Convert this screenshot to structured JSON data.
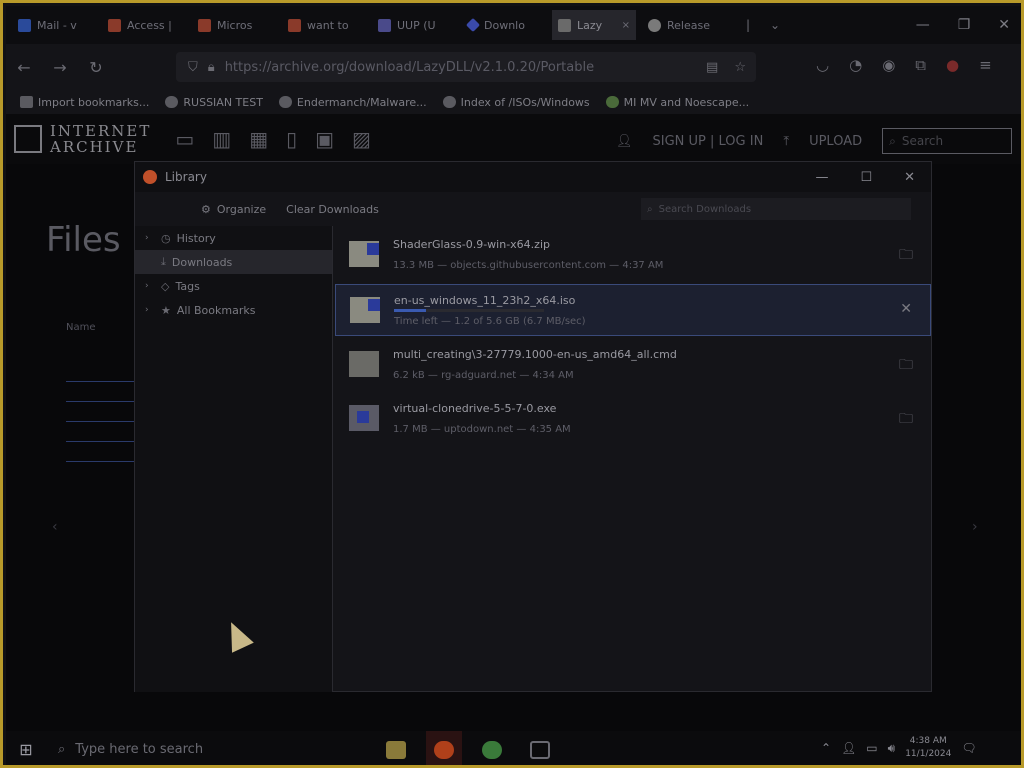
{
  "browser": {
    "tabs": [
      {
        "label": "Mail - v",
        "icon": "mail-icon",
        "color": "#2a4a9a"
      },
      {
        "label": "Access |",
        "icon": "microsoft-icon",
        "color": "#8a3a2a"
      },
      {
        "label": "Micros",
        "icon": "microsoft-icon",
        "color": "#8a3a2a"
      },
      {
        "label": "want to",
        "icon": "microsoft-icon",
        "color": "#8a3a2a"
      },
      {
        "label": "UUP (U",
        "icon": "page-icon",
        "color": "#4a4a8a"
      },
      {
        "label": "Downlo",
        "icon": "diamond-icon",
        "color": "#3a4aaa"
      },
      {
        "label": "Lazy",
        "icon": "archive-icon",
        "color": "#6a6a6a"
      },
      {
        "label": "Release",
        "icon": "github-icon",
        "color": "#7a7a7a"
      }
    ],
    "tab_close": "×",
    "url": "https://archive.org/download/LazyDLL/v2.1.0.20/Portable",
    "bookmarks": [
      "Import bookmarks...",
      "RUSSIAN TEST",
      "Endermanch/Malware...",
      "Index of /ISOs/Windows",
      "MI MV and Noescape..."
    ]
  },
  "page": {
    "logo_line1": "INTERNET",
    "logo_line2": "ARCHIVE",
    "signup": "SIGN UP | LOG IN",
    "upload": "UPLOAD",
    "search_placeholder": "Search",
    "files_title": "Files",
    "name_column": "Name"
  },
  "library": {
    "title": "Library",
    "organize": "Organize",
    "clear_downloads": "Clear Downloads",
    "search_placeholder": "Search Downloads",
    "sidebar": [
      {
        "label": "History",
        "icon": "clock-icon",
        "twisty": "›"
      },
      {
        "label": "Downloads",
        "icon": "download-icon",
        "twisty": ""
      },
      {
        "label": "Tags",
        "icon": "tag-icon",
        "twisty": "›"
      },
      {
        "label": "All Bookmarks",
        "icon": "star-icon",
        "twisty": "›"
      }
    ],
    "downloads": [
      {
        "name": "ShaderGlass-0.9-win-x64.zip",
        "status": "13.3 MB — objects.githubusercontent.com — 4:37 AM",
        "action": "folder-icon",
        "progress": null
      },
      {
        "name": "en-us_windows_11_23h2_x64.iso",
        "status": "Time left — 1.2 of 5.6 GB (6.7 MB/sec)",
        "action": "cancel-icon",
        "progress": 0.21
      },
      {
        "name": "multi_creating\\3-27779.1000-en-us_amd64_all.cmd",
        "status": "6.2 kB — rg-adguard.net — 4:34 AM",
        "action": "folder-icon",
        "progress": null
      },
      {
        "name": "virtual-clonedrive-5-5-7-0.exe",
        "status": "1.7 MB — uptodown.net — 4:35 AM",
        "action": "folder-icon",
        "progress": null
      }
    ]
  },
  "taskbar": {
    "search_placeholder": "Type here to search",
    "time": "4:38 AM",
    "date": "11/1/2024"
  }
}
